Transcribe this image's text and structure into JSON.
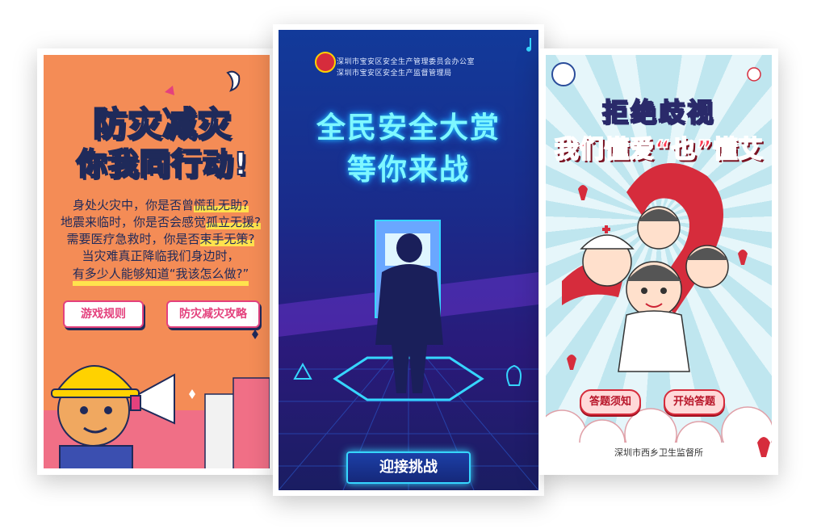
{
  "left_card": {
    "title_line1": "防灾减灾",
    "title_line2": "你我同行动!",
    "lines": [
      {
        "pre": "身处火灾中，你是否曾",
        "hl": "慌乱无助?"
      },
      {
        "pre": "地震来临时，你是否会感觉",
        "hl": "孤立无援?"
      },
      {
        "pre": "需要医疗急救时，你是否",
        "hl": "束手无策?"
      },
      {
        "pre": "当灾难真正降临我们身边时，",
        "hl": ""
      },
      {
        "pre": "有多少人能够知道“我该怎么做?”",
        "hl": ""
      }
    ],
    "buttons": [
      "游戏规则",
      "防灾减灾攻略"
    ]
  },
  "middle_card": {
    "org_line1": "深圳市宝安区安全生产管理委员会办公室",
    "org_line2": "深圳市宝安区安全生产监督管理局",
    "title_line1": "全民安全大赏",
    "title_line2": "等你来战",
    "button": "迎接挑战"
  },
  "right_card": {
    "title_line1": "拒绝歧视",
    "title_line2": "我们懂爱“也”懂艾",
    "buttons": [
      "答题须知",
      "开始答题"
    ],
    "footer": "深圳市西乡卫生监督所"
  },
  "colors": {
    "left_bg": "#f48c56",
    "middle_bg": "#1a2b8a",
    "right_bg": "#bfe6ef",
    "accent_pink": "#e4417d",
    "accent_red": "#d62c3c",
    "neon_cyan": "#7ef7ff"
  }
}
